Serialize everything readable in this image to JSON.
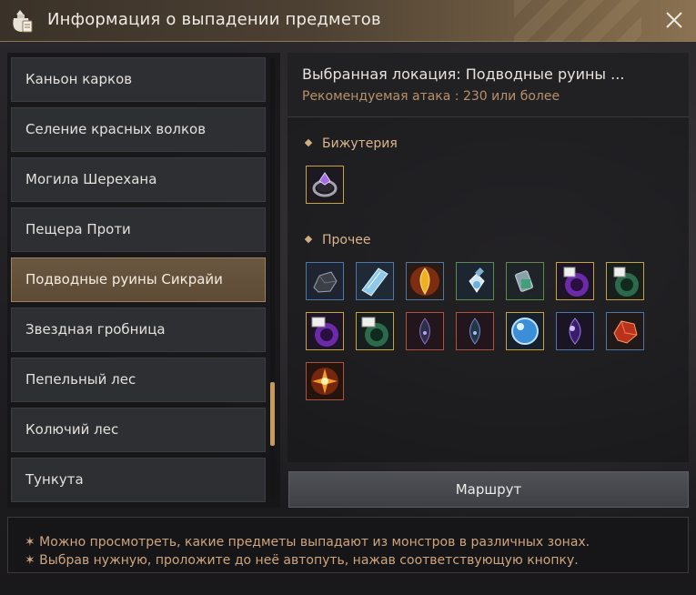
{
  "window": {
    "title": "Информация о выпадении предметов",
    "icon": "loot-bag-icon"
  },
  "locations": [
    {
      "label": "Каньон карков",
      "selected": false
    },
    {
      "label": "Селение красных волков",
      "selected": false
    },
    {
      "label": "Могила Шерехана",
      "selected": false
    },
    {
      "label": "Пещера Проти",
      "selected": false
    },
    {
      "label": "Подводные руины Сикрайи",
      "selected": true
    },
    {
      "label": "Звездная гробница",
      "selected": false
    },
    {
      "label": "Пепельный лес",
      "selected": false
    },
    {
      "label": "Колючий лес",
      "selected": false
    },
    {
      "label": "Тункута",
      "selected": false
    }
  ],
  "details": {
    "selected_location": "Выбранная локация: Подводные руины ...",
    "recommended_attack": "Рекомендуемая атака : 230 или более",
    "sections": [
      {
        "title": "Бижутерия",
        "items": [
          {
            "icon": "ring-icon",
            "border": "#c8a23c"
          }
        ]
      },
      {
        "title": "Прочее",
        "items": [
          {
            "icon": "black-stone-icon",
            "border": "#4a78a8"
          },
          {
            "icon": "crystal-shard-icon",
            "border": "#4a78a8"
          },
          {
            "icon": "flame-gem-icon",
            "border": "#4a78a8"
          },
          {
            "icon": "potion-icon",
            "border": "#5f8a4a"
          },
          {
            "icon": "scroll-pouch-icon",
            "border": "#5f8a4a"
          },
          {
            "icon": "purple-scroll-icon",
            "border": "#c8a23c"
          },
          {
            "icon": "green-scroll-icon",
            "border": "#c8a23c"
          },
          {
            "icon": "purple-scroll-icon",
            "border": "#c8a23c"
          },
          {
            "icon": "green-scroll-icon",
            "border": "#c8a23c"
          },
          {
            "icon": "dark-seed-icon",
            "border": "#b0503f"
          },
          {
            "icon": "dark-seed-icon",
            "border": "#b0503f"
          },
          {
            "icon": "blue-orb-icon",
            "border": "#c8a23c"
          },
          {
            "icon": "purple-gem-icon",
            "border": "#4a78a8"
          },
          {
            "icon": "red-gem-icon",
            "border": "#4a78a8"
          },
          {
            "icon": "fire-burst-icon",
            "border": "#b0503f"
          }
        ]
      }
    ]
  },
  "route_button": "Маршрут",
  "notes": [
    "✶ Можно просмотреть, какие предметы выпадают из монстров в различных зонах.",
    "✶ Выбрав нужную, проложите до неё автопуть, нажав соответствующую кнопку."
  ]
}
